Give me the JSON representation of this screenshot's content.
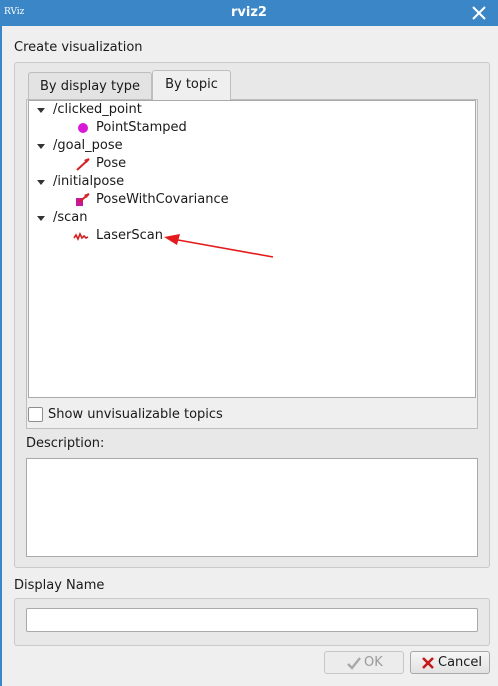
{
  "window": {
    "title": "rviz2",
    "app_logo": "RViz",
    "close_icon": "close-icon"
  },
  "create_visualization": {
    "label": "Create visualization",
    "tabs": [
      {
        "label": "By display type",
        "active": false
      },
      {
        "label": "By topic",
        "active": true
      }
    ],
    "topics": [
      {
        "topic": "/clicked_point",
        "display": "PointStamped",
        "icon": "point-stamped-icon",
        "expanded": true
      },
      {
        "topic": "/goal_pose",
        "display": "Pose",
        "icon": "pose-arrow-icon",
        "expanded": true
      },
      {
        "topic": "/initialpose",
        "display": "PoseWithCovariance",
        "icon": "pose-covariance-icon",
        "expanded": true
      },
      {
        "topic": "/scan",
        "display": "LaserScan",
        "icon": "laser-scan-icon",
        "expanded": true
      }
    ],
    "show_unvisualizable": {
      "label": "Show unvisualizable topics",
      "checked": false
    },
    "annotation_color": "#e41a1c"
  },
  "description": {
    "label": "Description:",
    "text": ""
  },
  "display_name": {
    "label": "Display Name",
    "value": "",
    "placeholder": ""
  },
  "buttons": {
    "ok": {
      "label": "OK",
      "enabled": false,
      "icon": "check-icon"
    },
    "cancel": {
      "label": "Cancel",
      "enabled": true,
      "icon": "cancel-x-icon"
    }
  },
  "colors": {
    "titlebar": "#3b86c7",
    "point_icon": "#d61ad6",
    "pose_icon": "#d42020"
  }
}
